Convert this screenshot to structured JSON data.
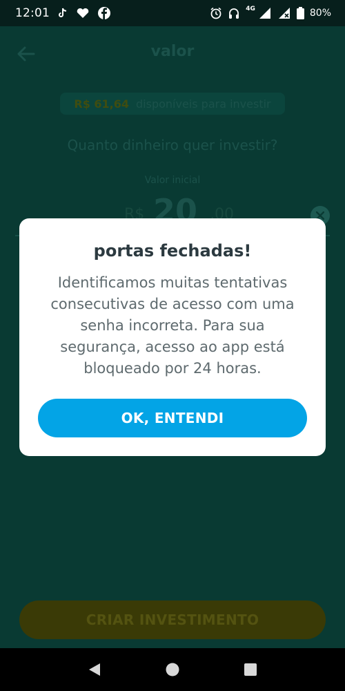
{
  "status_bar": {
    "time": "12:01",
    "network": "4G",
    "battery": "80%",
    "left_icons": [
      "tiktok-icon",
      "heart-icon",
      "facebook-icon"
    ],
    "right_icons": [
      "alarm-icon",
      "headset-icon",
      "signal-icon",
      "battery-icon"
    ]
  },
  "header": {
    "title": "valor"
  },
  "balance": {
    "amount": "R$ 61,64",
    "text": "disponíveis para investir"
  },
  "form": {
    "question": "Quanto dinheiro quer investir?",
    "value_label": "Valor inicial",
    "currency": "R$",
    "amount": "20",
    "cents": ",00"
  },
  "create_button_label": "CRIAR INVESTIMENTO",
  "modal": {
    "title": "portas fechadas!",
    "body": "Identificamos muitas tentativas consecutivas de acesso com uma senha incorreta. Para sua segurança, acesso ao app está bloqueado por 24 horas.",
    "button_label": "OK, ENTENDI"
  },
  "colors": {
    "overlay_bg": "#093a33",
    "modal_button": "#03a4e6",
    "modal_title": "#2c3a40",
    "modal_body": "#5e6a6e"
  }
}
